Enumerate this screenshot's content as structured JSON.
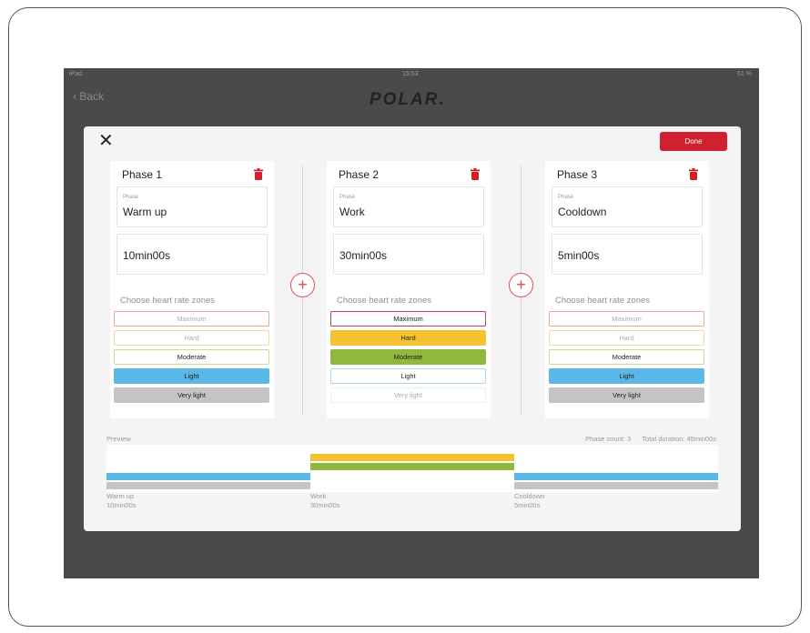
{
  "statusbar": {
    "left": "iPad",
    "time": "15:53",
    "right": "61 %"
  },
  "nav": {
    "back": "Back",
    "logo": "POLAR."
  },
  "modal": {
    "done_label": "Done",
    "close_icon": "close-icon"
  },
  "phases": [
    {
      "title": "Phase 1",
      "field_label": "Phase",
      "name": "Warm up",
      "duration": "10min00s"
    },
    {
      "title": "Phase 2",
      "field_label": "Phase",
      "name": "Work",
      "duration": "30min00s"
    },
    {
      "title": "Phase 3",
      "field_label": "Phase",
      "name": "Cooldown",
      "duration": "5min00s"
    }
  ],
  "zones_label": "Choose heart rate zones",
  "zones": [
    "Maximum",
    "Hard",
    "Moderate",
    "Light",
    "Very light"
  ],
  "zone_colors": {
    "Maximum": "#d1202f",
    "Hard": "#f6c230",
    "Moderate": "#8fb83c",
    "Light": "#5ab7e6",
    "Very light": "#c4c4c4"
  },
  "phase_zones": [
    [
      "Light",
      "Very light"
    ],
    [
      "Hard",
      "Moderate"
    ],
    [
      "Light",
      "Very light"
    ]
  ],
  "preview": {
    "label": "Preview",
    "phase_count": "Phase count: 3",
    "total_duration": "Total duration: 45min00s",
    "captions": [
      {
        "name": "Warm up",
        "duration": "10min00s"
      },
      {
        "name": "Work",
        "duration": "30min00s"
      },
      {
        "name": "Cooldown",
        "duration": "5min00s"
      }
    ]
  }
}
